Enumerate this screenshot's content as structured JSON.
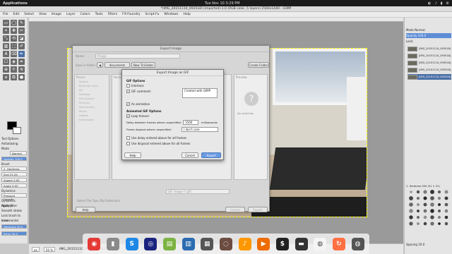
{
  "topbar": {
    "app": "Applications",
    "clock": "Tue Nov 10  3:29 PM",
    "tray": [
      "◐",
      "♪",
      "▮",
      "⚙"
    ]
  },
  "window": {
    "title": "*[IMG_20151110_093518] (imported)-1.0 (RGB color, 5 layers) 2560x1440 – GIMP"
  },
  "menubar": [
    "File",
    "Edit",
    "Select",
    "View",
    "Image",
    "Layer",
    "Colors",
    "Tools",
    "Filters",
    "FX-Foundry",
    "Script-Fu",
    "Windows",
    "Help"
  ],
  "toolbox": {
    "tools": [
      "▭",
      "◯",
      "✎",
      "⌖",
      "✥",
      "✂",
      "⤡",
      "⟲",
      "◪",
      "▥",
      "⬚",
      "✐",
      "A",
      "⌫",
      "✏",
      "☐",
      "◈",
      "✒",
      "⊕",
      "☼",
      "≋",
      "⌀",
      "⧉",
      "●"
    ],
    "tool_options": "Tool Options",
    "antialias": "Antialiasing",
    "mode_label": "Mode",
    "mode_value": "Normal",
    "opacity_label": "Opacity",
    "opacity_value": "100.0",
    "brush_label": "Brush",
    "brush_value": "2. Hardness",
    "size_label": "Size",
    "size_value": "51.00",
    "aspect_label": "Aspect",
    "aspect_value": "0.00",
    "angle_label": "Angle",
    "angle_value": "0.00",
    "dynamics_label": "Dynamics",
    "dynamics_value": "Pressure Opacity",
    "dyn_options": "Dynamics Options",
    "apply_jitter": "Apply Jitter",
    "smooth": "Smooth stroke",
    "lock": "Lock brush to view",
    "incremental": "Incremental",
    "hardness": "Hardness",
    "hardness_value": "40.0",
    "force": "Force",
    "force_value": "50.0"
  },
  "status": {
    "zoom_unit": "px",
    "zoom": "50 %",
    "layer": "IMG_20151110_093518 (137.3 MB)"
  },
  "dock": [
    {
      "glyph": "◉",
      "color": "#e53935"
    },
    {
      "glyph": "▮",
      "color": "#8a8a8a"
    },
    {
      "glyph": "S",
      "color": "#1e88e5"
    },
    {
      "glyph": "◎",
      "color": "#1a237e"
    },
    {
      "glyph": "▤",
      "color": "#7cb342"
    },
    {
      "glyph": "▥",
      "color": "#2b6cb0"
    },
    {
      "glyph": "▦",
      "color": "#555"
    },
    {
      "glyph": "◌",
      "color": "#6d4c41"
    },
    {
      "glyph": "♪",
      "color": "#ff9800"
    },
    {
      "glyph": "▶",
      "color": "#ef6c00"
    },
    {
      "glyph": "$",
      "color": "#222"
    },
    {
      "glyph": "▬",
      "color": "#333"
    },
    {
      "glyph": "◍",
      "color": "#f5f5f5"
    },
    {
      "glyph": "↻",
      "color": "#ff7043"
    },
    {
      "glyph": "◍",
      "color": "#555"
    }
  ],
  "right": {
    "mode": "Normal",
    "opacity": "100.0",
    "lock": "Lock:",
    "layers": [
      "[IMG_20151110_093518]",
      "[IMG_20151110_093518]",
      "[IMG_20151110_093518]",
      "[IMG_20151110_093518]",
      "[IMG_20151110_093518]"
    ],
    "brushes_title": "2. Hardness 050 (51 × 51)",
    "spacing": "Spacing",
    "spacing_value": "10.0"
  },
  "export": {
    "title": "Export Image",
    "name_label": "Name:",
    "name_value": "Image",
    "save_label": "Save in folder:",
    "crumbs": [
      "◀",
      "documents",
      "New TinFolder"
    ],
    "create_folder": "Create Folder",
    "places_header": "Places",
    "places": [
      "Search",
      "Recently Used",
      "kill",
      "Desktop",
      "File System",
      "Pictures",
      "Documents",
      "Music",
      "Videos",
      "Downloads"
    ],
    "name_col": "Name",
    "preview": "Preview",
    "no_selection": "No selection",
    "filetype": "GIF image (*.gif)",
    "select_type": "Select File Type (By Extension)",
    "help": "Help",
    "cancel": "Cancel",
    "export": "Export"
  },
  "gif": {
    "title": "Export Image as GIF",
    "gif_options": "GIF Options",
    "interlace": "Interlace",
    "comment": "GIF comment:",
    "comment_value": "Created with GIMP",
    "as_animation": "As animation",
    "anim_options": "Animated GIF Options",
    "loop": "Loop forever",
    "delay_label": "Delay between frames where unspecified:",
    "delay_value": "1500",
    "delay_unit": "milliseconds",
    "disposal_label": "Frame disposal where unspecified:",
    "disposal_value": "I don't care",
    "use_delay": "Use delay entered above for all frames",
    "use_disposal": "Use disposal entered above for all frames",
    "help": "Help",
    "cancel": "Cancel",
    "export": "Export"
  }
}
